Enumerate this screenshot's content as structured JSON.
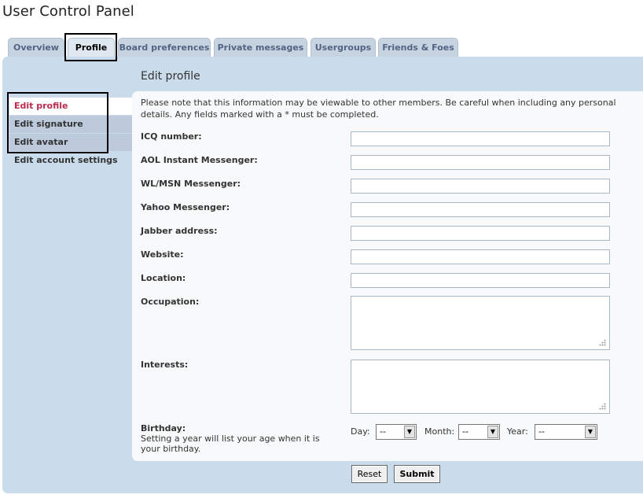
{
  "page_title": "User Control Panel",
  "tabs": [
    {
      "label": "Overview"
    },
    {
      "label": "Profile"
    },
    {
      "label": "Board preferences"
    },
    {
      "label": "Private messages"
    },
    {
      "label": "Usergroups"
    },
    {
      "label": "Friends & Foes"
    }
  ],
  "active_tab": "Profile",
  "sidebar": {
    "items": [
      {
        "label": "Edit profile",
        "active": true
      },
      {
        "label": "Edit signature"
      },
      {
        "label": "Edit avatar"
      },
      {
        "label": "Edit account settings"
      }
    ]
  },
  "main": {
    "title": "Edit profile",
    "notice": "Please note that this information may be viewable to other members. Be careful when including any personal details. Any fields marked with a * must be completed.",
    "fields": [
      {
        "label": "ICQ number:",
        "value": ""
      },
      {
        "label": "AOL Instant Messenger:",
        "value": ""
      },
      {
        "label": "WL/MSN Messenger:",
        "value": ""
      },
      {
        "label": "Yahoo Messenger:",
        "value": ""
      },
      {
        "label": "Jabber address:",
        "value": ""
      },
      {
        "label": "Website:",
        "value": ""
      },
      {
        "label": "Location:",
        "value": ""
      },
      {
        "label": "Occupation:",
        "value": ""
      },
      {
        "label": "Interests:",
        "value": ""
      }
    ],
    "birthday": {
      "label": "Birthday:",
      "hint": "Setting a year will list your age when it is your birthday.",
      "day_label": "Day:",
      "day_value": "--",
      "month_label": "Month:",
      "month_value": "--",
      "year_label": "Year:",
      "year_value": "--"
    },
    "buttons": {
      "reset": "Reset",
      "submit": "Submit"
    }
  },
  "colors": {
    "panel_bg": "#cadceb",
    "tab_bg": "#c6d4e2",
    "tab_text": "#536482",
    "active_menu_text": "#bc2a4d",
    "content_bg": "#f8f9fa"
  }
}
